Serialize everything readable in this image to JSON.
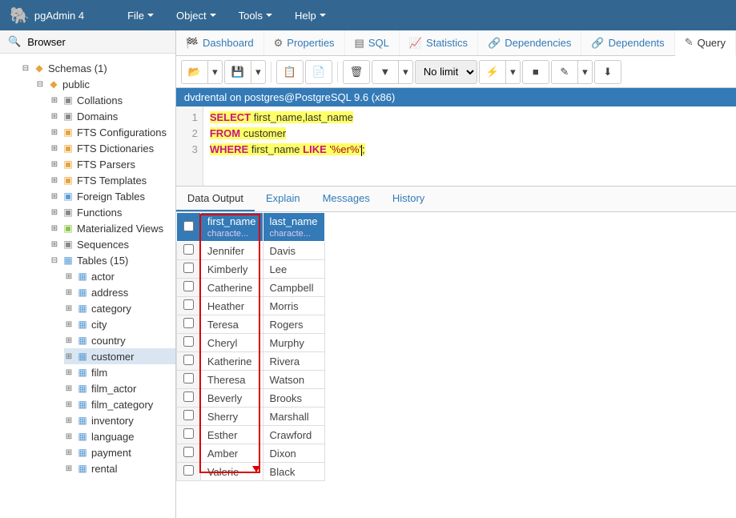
{
  "app": {
    "title": "pgAdmin 4"
  },
  "topmenu": [
    "File",
    "Object",
    "Tools",
    "Help"
  ],
  "browser": {
    "title": "Browser"
  },
  "tree": {
    "schemas": "Schemas (1)",
    "public": "public",
    "nodes": [
      "Collations",
      "Domains",
      "FTS Configurations",
      "FTS Dictionaries",
      "FTS Parsers",
      "FTS Templates",
      "Foreign Tables",
      "Functions",
      "Materialized Views",
      "Sequences"
    ],
    "tables_label": "Tables (15)",
    "tables": [
      "actor",
      "address",
      "category",
      "city",
      "country",
      "customer",
      "film",
      "film_actor",
      "film_category",
      "inventory",
      "language",
      "payment",
      "rental"
    ]
  },
  "tabs": {
    "dashboard": "Dashboard",
    "properties": "Properties",
    "sql": "SQL",
    "stats": "Statistics",
    "deps": "Dependencies",
    "dependents": "Dependents",
    "query": "Query"
  },
  "toolbar": {
    "limit": "No limit"
  },
  "connection": "dvdrental on postgres@PostgreSQL 9.6 (x86)",
  "sql": {
    "lines": [
      "1",
      "2",
      "3"
    ],
    "l1_kw": "SELECT",
    "l1_rest": " first_name,last_name",
    "l2_kw": "FROM",
    "l2_rest": " customer",
    "l3_kw1": "WHERE",
    "l3_mid": " first_name ",
    "l3_kw2": "LIKE",
    "l3_str": " '%er%'",
    "l3_end": ";"
  },
  "result_tabs": {
    "output": "Data Output",
    "explain": "Explain",
    "messages": "Messages",
    "history": "History"
  },
  "columns": [
    {
      "name": "first_name",
      "type": "characte..."
    },
    {
      "name": "last_name",
      "type": "characte..."
    }
  ],
  "rows": [
    {
      "f": "Jennifer",
      "l": "Davis"
    },
    {
      "f": "Kimberly",
      "l": "Lee"
    },
    {
      "f": "Catherine",
      "l": "Campbell"
    },
    {
      "f": "Heather",
      "l": "Morris"
    },
    {
      "f": "Teresa",
      "l": "Rogers"
    },
    {
      "f": "Cheryl",
      "l": "Murphy"
    },
    {
      "f": "Katherine",
      "l": "Rivera"
    },
    {
      "f": "Theresa",
      "l": "Watson"
    },
    {
      "f": "Beverly",
      "l": "Brooks"
    },
    {
      "f": "Sherry",
      "l": "Marshall"
    },
    {
      "f": "Esther",
      "l": "Crawford"
    },
    {
      "f": "Amber",
      "l": "Dixon"
    },
    {
      "f": "Valerie",
      "l": "Black"
    }
  ]
}
